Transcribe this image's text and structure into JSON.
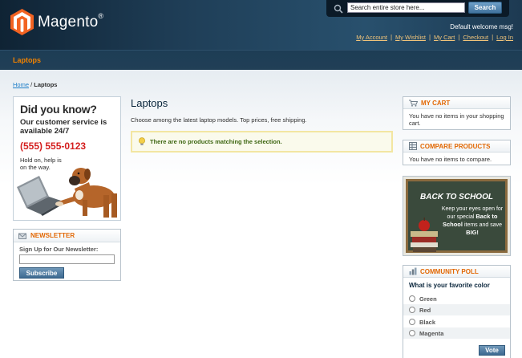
{
  "header": {
    "logo_text": "Magento",
    "logo_reg": "®",
    "search": {
      "value": "Search entire store here...",
      "button": "Search"
    },
    "welcome": "Default welcome msg!",
    "links": [
      "My Account",
      "My Wishlist",
      "My Cart",
      "Checkout",
      "Log In"
    ]
  },
  "nav": {
    "items": [
      "Laptops"
    ]
  },
  "breadcrumb": {
    "home": "Home",
    "separator": "/",
    "current": "Laptops"
  },
  "callout": {
    "title": "Did you know?",
    "subtitle": "Our customer service is available 24/7",
    "phone": "(555) 555-0123",
    "hold": "Hold on, help is on the way."
  },
  "newsletter": {
    "title": "NEWSLETTER",
    "label": "Sign Up for Our Newsletter:",
    "button": "Subscribe"
  },
  "main": {
    "title": "Laptops",
    "description": "Choose among the latest laptop models. Top prices, free shipping.",
    "notice": "There are no products matching the selection."
  },
  "cart": {
    "title": "MY CART",
    "empty": "You have no items in your shopping cart."
  },
  "compare": {
    "title": "COMPARE PRODUCTS",
    "empty": "You have no items to compare."
  },
  "banner": {
    "title": "BACK TO SCHOOL",
    "line1": "Keep your eyes open for our special",
    "highlight": "Back to School",
    "line2": "items and save",
    "big": "BIG!"
  },
  "poll": {
    "title": "COMMUNITY POLL",
    "question": "What is your favorite color",
    "options": [
      "Green",
      "Red",
      "Black",
      "Magenta"
    ],
    "button": "Vote"
  },
  "colors": {
    "accent": "#e26703",
    "nav_text": "#f18200",
    "link": "#1e7ec8",
    "header_bg": "#1f3e57"
  }
}
